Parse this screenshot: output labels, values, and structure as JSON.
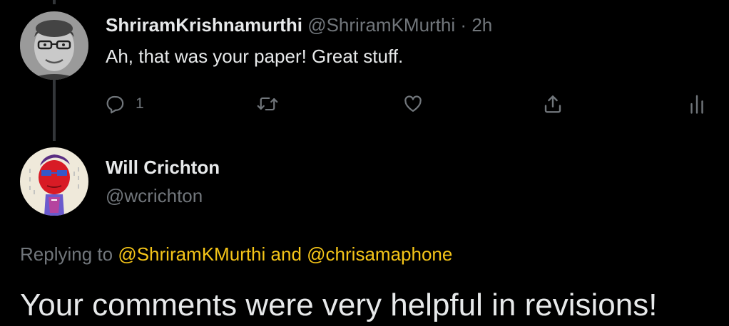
{
  "colors": {
    "background": "#000000",
    "text_primary": "#e7e9ea",
    "text_secondary": "#71767b",
    "mention": "#f5c518",
    "thread_line": "#333639"
  },
  "tweet1": {
    "display_name": "ShriramKrishnamurthi",
    "handle": "@ShriramKMurthi",
    "separator": "·",
    "time": "2h",
    "text": "Ah, that was your paper! Great stuff.",
    "actions": {
      "reply_icon": "reply-icon",
      "reply_count": "1",
      "retweet_icon": "retweet-icon",
      "like_icon": "heart-icon",
      "share_icon": "share-icon",
      "analytics_icon": "analytics-icon"
    }
  },
  "tweet2": {
    "display_name": "Will Crichton",
    "handle": "@wcrichton",
    "replying_prefix": "Replying to",
    "reply_mention_1": "@ShriramKMurthi",
    "reply_conjunction": "and",
    "reply_mention_2": "@chrisamaphone",
    "text": "Your comments were very helpful in revisions!"
  }
}
